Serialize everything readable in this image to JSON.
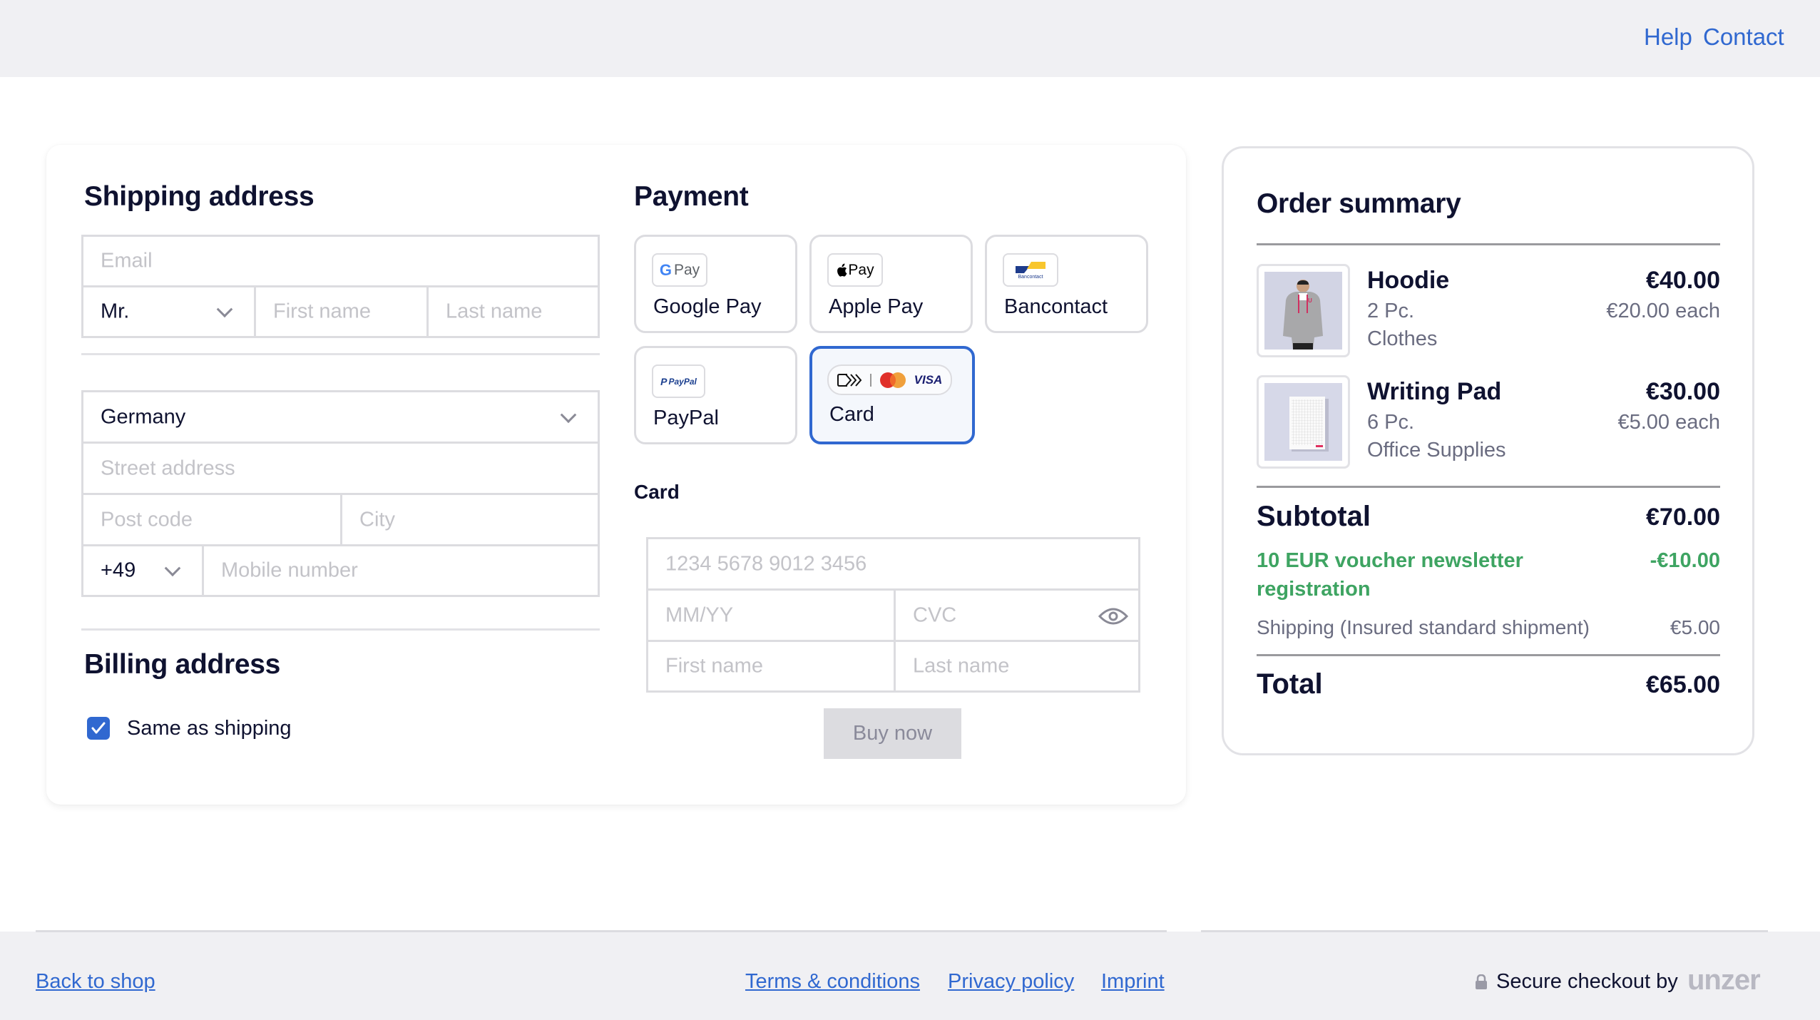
{
  "header": {
    "links": [
      {
        "label": "Help"
      },
      {
        "label": "Contact"
      }
    ]
  },
  "shipping": {
    "title": "Shipping address",
    "email_placeholder": "Email",
    "salutation_value": "Mr.",
    "first_name_placeholder": "First name",
    "last_name_placeholder": "Last name",
    "country_value": "Germany",
    "street_placeholder": "Street address",
    "postcode_placeholder": "Post code",
    "city_placeholder": "City",
    "phone_prefix_value": "+49",
    "mobile_placeholder": "Mobile number"
  },
  "billing": {
    "title": "Billing address",
    "same_as_shipping_label": "Same as shipping",
    "same_as_shipping_checked": true
  },
  "payment": {
    "title": "Payment",
    "methods": [
      {
        "label": "Google Pay",
        "logo": "google-pay-logo",
        "logo_text": "Pay",
        "selected": false
      },
      {
        "label": "Apple Pay",
        "logo": "apple-pay-logo",
        "logo_text": "Pay",
        "selected": false
      },
      {
        "label": "Bancontact",
        "logo": "bancontact-logo",
        "logo_text": "Bancontact",
        "selected": false
      },
      {
        "label": "PayPal",
        "logo": "paypal-logo",
        "logo_text": "PayPal",
        "selected": false
      },
      {
        "label": "Card",
        "logo": "card-brands-logo",
        "logo_text": "VISA",
        "selected": true
      }
    ],
    "card_section_label": "Card",
    "card_number_placeholder": "1234 5678 9012 3456",
    "expiry_placeholder": "MM/YY",
    "cvc_placeholder": "CVC",
    "card_first_name_placeholder": "First name",
    "card_last_name_placeholder": "Last name",
    "buy_button": "Buy now"
  },
  "summary": {
    "title": "Order summary",
    "items": [
      {
        "name": "Hoodie",
        "quantity": "2 Pc.",
        "category": "Clothes",
        "price": "€40.00",
        "unit_price": "€20.00 each"
      },
      {
        "name": "Writing Pad",
        "quantity": "6 Pc.",
        "category": "Office Supplies",
        "price": "€30.00",
        "unit_price": "€5.00 each"
      }
    ],
    "subtotal_label": "Subtotal",
    "subtotal_value": "€70.00",
    "voucher_label": "10 EUR voucher newsletter registration",
    "voucher_value": "-€10.00",
    "shipping_label": "Shipping (Insured standard shipment)",
    "shipping_value": "€5.00",
    "total_label": "Total",
    "total_value": "€65.00"
  },
  "footer": {
    "back_to_shop": "Back to shop",
    "links": [
      {
        "label": "Terms & conditions"
      },
      {
        "label": "Privacy policy"
      },
      {
        "label": "Imprint"
      }
    ],
    "secure_text": "Secure checkout by",
    "brand": "unzer"
  },
  "colors": {
    "accent": "#3068d0",
    "heading": "#0f1230",
    "muted": "#6a6c80",
    "placeholder": "#c3c3c8",
    "border": "#dcdce0",
    "success": "#3ea462",
    "surface": "#f0f0f3"
  }
}
